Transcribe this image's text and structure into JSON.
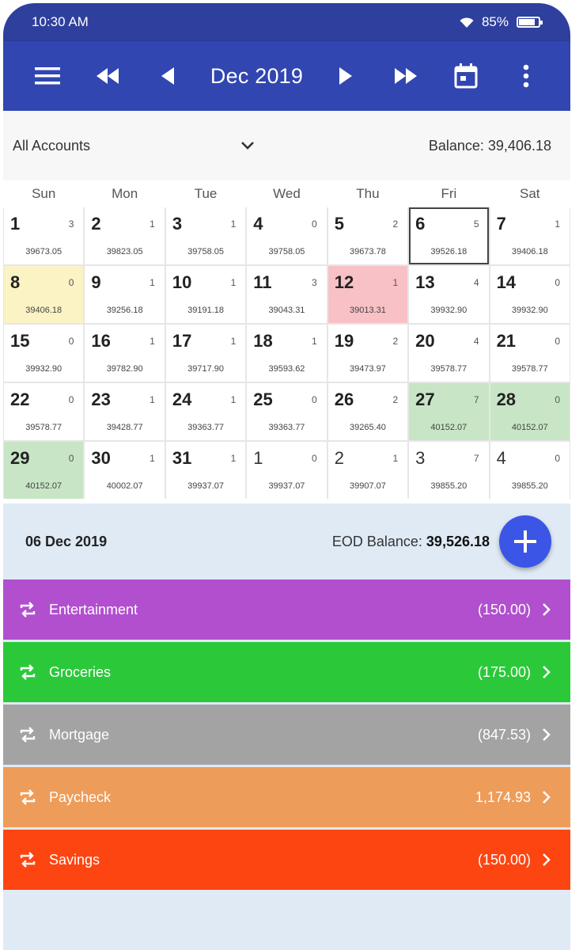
{
  "status": {
    "time": "10:30 AM",
    "battery": "85%",
    "battery_level": 0.85
  },
  "toolbar": {
    "month": "Dec 2019"
  },
  "filter": {
    "account": "All Accounts",
    "balance": "Balance: 39,406.18"
  },
  "weekdays": [
    "Sun",
    "Mon",
    "Tue",
    "Wed",
    "Thu",
    "Fri",
    "Sat"
  ],
  "days": [
    {
      "d": "1",
      "c": "3",
      "b": "39673.05"
    },
    {
      "d": "2",
      "c": "1",
      "b": "39823.05"
    },
    {
      "d": "3",
      "c": "1",
      "b": "39758.05"
    },
    {
      "d": "4",
      "c": "0",
      "b": "39758.05"
    },
    {
      "d": "5",
      "c": "2",
      "b": "39673.78"
    },
    {
      "d": "6",
      "c": "5",
      "b": "39526.18",
      "state": "sel"
    },
    {
      "d": "7",
      "c": "1",
      "b": "39406.18"
    },
    {
      "d": "8",
      "c": "0",
      "b": "39406.18",
      "state": "yellow"
    },
    {
      "d": "9",
      "c": "1",
      "b": "39256.18"
    },
    {
      "d": "10",
      "c": "1",
      "b": "39191.18"
    },
    {
      "d": "11",
      "c": "3",
      "b": "39043.31"
    },
    {
      "d": "12",
      "c": "1",
      "b": "39013.31",
      "state": "red"
    },
    {
      "d": "13",
      "c": "4",
      "b": "39932.90"
    },
    {
      "d": "14",
      "c": "0",
      "b": "39932.90"
    },
    {
      "d": "15",
      "c": "0",
      "b": "39932.90"
    },
    {
      "d": "16",
      "c": "1",
      "b": "39782.90"
    },
    {
      "d": "17",
      "c": "1",
      "b": "39717.90"
    },
    {
      "d": "18",
      "c": "1",
      "b": "39593.62"
    },
    {
      "d": "19",
      "c": "2",
      "b": "39473.97"
    },
    {
      "d": "20",
      "c": "4",
      "b": "39578.77"
    },
    {
      "d": "21",
      "c": "0",
      "b": "39578.77"
    },
    {
      "d": "22",
      "c": "0",
      "b": "39578.77"
    },
    {
      "d": "23",
      "c": "1",
      "b": "39428.77"
    },
    {
      "d": "24",
      "c": "1",
      "b": "39363.77"
    },
    {
      "d": "25",
      "c": "0",
      "b": "39363.77"
    },
    {
      "d": "26",
      "c": "2",
      "b": "39265.40"
    },
    {
      "d": "27",
      "c": "7",
      "b": "40152.07",
      "state": "green"
    },
    {
      "d": "28",
      "c": "0",
      "b": "40152.07",
      "state": "green"
    },
    {
      "d": "29",
      "c": "0",
      "b": "40152.07",
      "state": "green"
    },
    {
      "d": "30",
      "c": "1",
      "b": "40002.07"
    },
    {
      "d": "31",
      "c": "1",
      "b": "39937.07"
    },
    {
      "d": "1",
      "c": "0",
      "b": "39937.07",
      "state": "other"
    },
    {
      "d": "2",
      "c": "1",
      "b": "39907.07",
      "state": "other"
    },
    {
      "d": "3",
      "c": "7",
      "b": "39855.20",
      "state": "other"
    },
    {
      "d": "4",
      "c": "0",
      "b": "39855.20",
      "state": "other"
    }
  ],
  "day_summary": {
    "date": "06 Dec 2019",
    "eod_label": "EOD Balance:",
    "eod_value": "39,526.18"
  },
  "transactions": [
    {
      "name": "Entertainment",
      "amount": "(150.00)",
      "color": "#b14fce"
    },
    {
      "name": "Groceries",
      "amount": "(175.00)",
      "color": "#2bc93a"
    },
    {
      "name": "Mortgage",
      "amount": "(847.53)",
      "color": "#a3a3a3"
    },
    {
      "name": "Paycheck",
      "amount": "1,174.93",
      "color": "#ee9c59"
    },
    {
      "name": "Savings",
      "amount": "(150.00)",
      "color": "#fd4511"
    }
  ],
  "colors": {
    "toolbar": "#3146b0",
    "status": "#2f3f9e",
    "fab": "#3b55e6",
    "background": "#dfeaf5"
  }
}
